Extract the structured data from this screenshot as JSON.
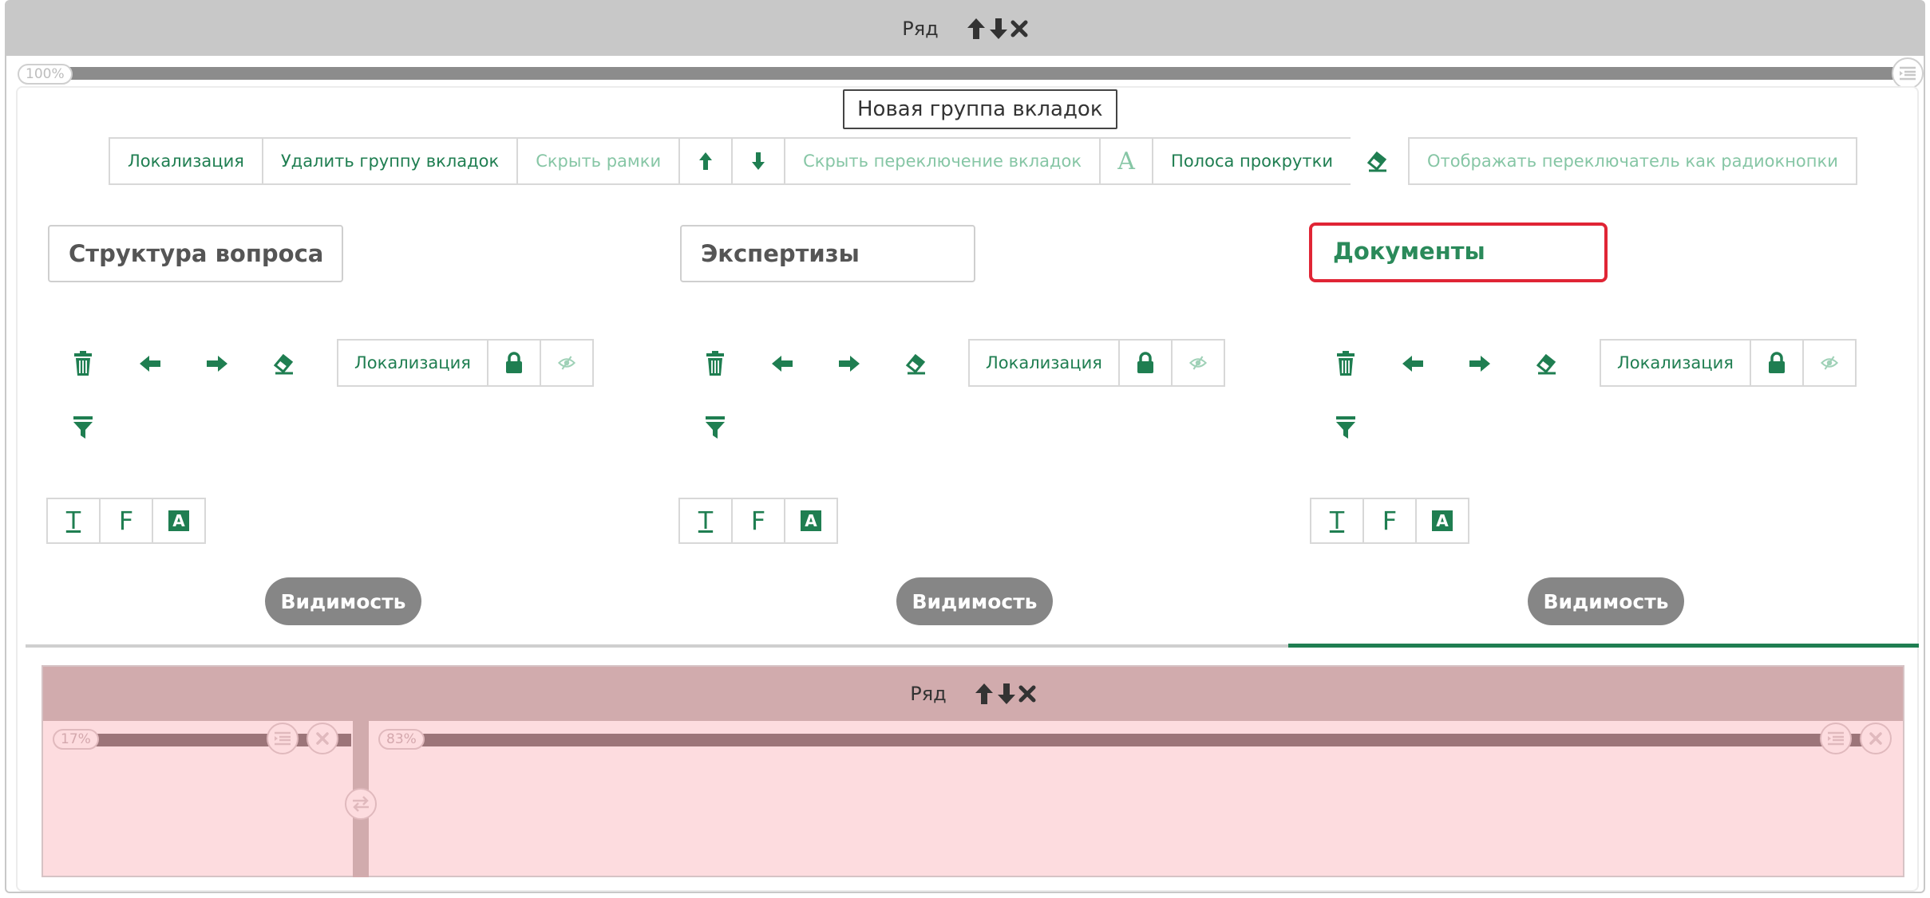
{
  "row": {
    "title": "Ряд",
    "width_percent": "100%"
  },
  "tab_group": {
    "name": "Новая группа вкладок",
    "toolbar": {
      "localization": "Локализация",
      "delete_group": "Удалить группу вкладок",
      "hide_frames": "Скрыть рамки",
      "hide_tab_switch": "Скрыть переключение вкладок",
      "font_glyph": "A",
      "scrollbar": "Полоса прокрутки",
      "radio_switch": "Отображать переключатель как радиокнопки"
    },
    "active_tab_index": 2,
    "tabs": [
      {
        "title": "Структура вопроса",
        "localization": "Локализация",
        "visibility": "Видимость"
      },
      {
        "title": "Экспертизы",
        "localization": "Локализация",
        "visibility": "Видимость"
      },
      {
        "title": "Документы",
        "localization": "Локализация",
        "visibility": "Видимость"
      }
    ],
    "format_glyphs": {
      "text": "T",
      "font": "F",
      "style": "A"
    }
  },
  "nested_row": {
    "title": "Ряд",
    "columns": [
      {
        "width_percent": "17%"
      },
      {
        "width_percent": "83%"
      }
    ]
  },
  "colors": {
    "accent_green": "#1f7e51",
    "active_border": "#e02535",
    "header_gray": "#c8c8c8",
    "nested_bg": "#fddcdf",
    "nested_header": "#d1abad"
  }
}
